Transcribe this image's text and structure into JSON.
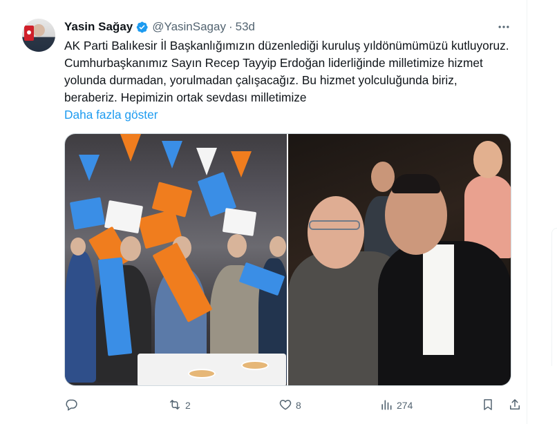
{
  "tweet": {
    "author_name": "Yasin Sağay",
    "handle": "@YasinSagay",
    "separator": "·",
    "time": "53d",
    "text": "AK Parti Balıkesir İl Başkanlığımızın düzenlediği kuruluş yıldönümümüzü kutluyoruz. Cumhurbaşkanımız Sayın Recep Tayyip Erdoğan liderliğinde milletimize hizmet yolunda durmadan, yorulmadan çalışacağız. Bu hizmet yolculuğunda biriz, beraberiz. Hepimizin ortak sevdası milletimize",
    "show_more": "Daha fazla göster"
  },
  "actions": {
    "reply_count": "",
    "retweet_count": "2",
    "like_count": "8",
    "views_count": "274"
  },
  "colors": {
    "accent": "#1d9bf0",
    "secondary_text": "#536471",
    "border": "#cfd9de",
    "party_orange": "#f07d1e",
    "party_blue": "#3a8ee6"
  },
  "icons": {
    "verified": "verified-badge-icon",
    "more": "more-horizontal-icon",
    "reply": "reply-icon",
    "retweet": "retweet-icon",
    "like": "heart-icon",
    "views": "views-chart-icon",
    "bookmark": "bookmark-icon",
    "share": "share-icon"
  }
}
